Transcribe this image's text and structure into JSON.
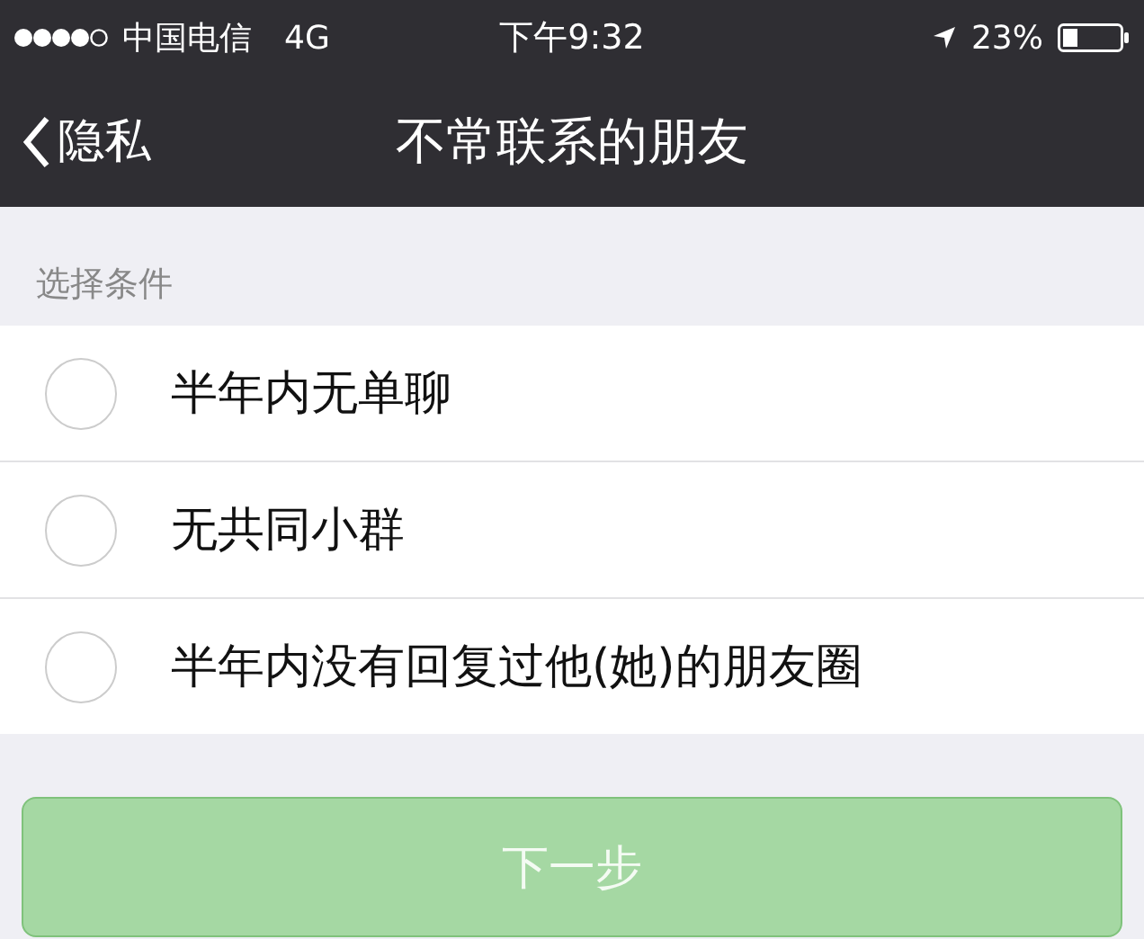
{
  "status_bar": {
    "carrier": "中国电信",
    "network": "4G",
    "time": "下午9:32",
    "battery": "23%"
  },
  "nav": {
    "back": "隐私",
    "title": "不常联系的朋友"
  },
  "section": {
    "header": "选择条件"
  },
  "options": [
    {
      "label": "半年内无单聊",
      "checked": false
    },
    {
      "label": "无共同小群",
      "checked": false
    },
    {
      "label": "半年内没有回复过他(她)的朋友圈",
      "checked": false
    }
  ],
  "next_button": {
    "label": "下一步",
    "disabled": true
  }
}
